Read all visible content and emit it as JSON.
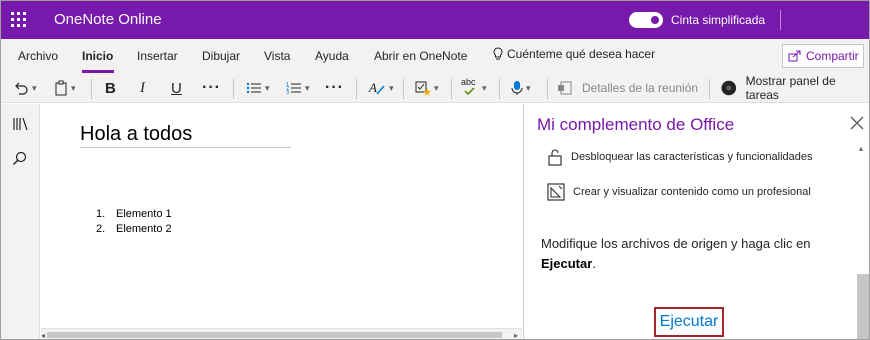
{
  "titlebar": {
    "app_name": "OneNote Online",
    "toggle_label": "Cinta simplificada",
    "toggle_on": true,
    "accent": "#7719aa"
  },
  "menu": {
    "tabs": [
      "Archivo",
      "Inicio",
      "Insertar",
      "Dibujar",
      "Vista",
      "Ayuda",
      "Abrir en OneNote"
    ],
    "active_tab": "Inicio",
    "tell_me": "Cuénteme qué desea hacer",
    "share": "Compartir"
  },
  "ribbon": {
    "meeting_details": "Detalles de la reunión",
    "show_taskpane": "Mostrar panel de tareas",
    "icons": [
      "undo-icon",
      "paste-icon",
      "bold-icon",
      "italic-icon",
      "underline-icon",
      "more-icon",
      "bullets-icon",
      "numbering-icon",
      "more-icon",
      "styles-icon",
      "tag-icon",
      "spelling-icon",
      "dictate-icon",
      "meeting-icon",
      "addin-icon"
    ],
    "bold": "B",
    "italic": "I",
    "underline": "U",
    "spelling": "abc"
  },
  "rail": {
    "icons": [
      "notebooks-icon",
      "search-icon"
    ]
  },
  "page": {
    "title": "Hola a todos",
    "list": [
      {
        "num": "1.",
        "text": "Elemento 1"
      },
      {
        "num": "2.",
        "text": "Elemento 2"
      }
    ]
  },
  "taskpane": {
    "title": "Mi complemento de Office",
    "features": [
      "Desbloquear las características y funcionalidades",
      "Crear y visualizar contenido como un profesional"
    ],
    "description_prefix": "Modifique los archivos de origen y haga clic en ",
    "description_bold": "Ejecutar",
    "description_suffix": ".",
    "run_button": "Ejecutar",
    "run_border": "#a4262c",
    "link_color": "#0078d4"
  }
}
